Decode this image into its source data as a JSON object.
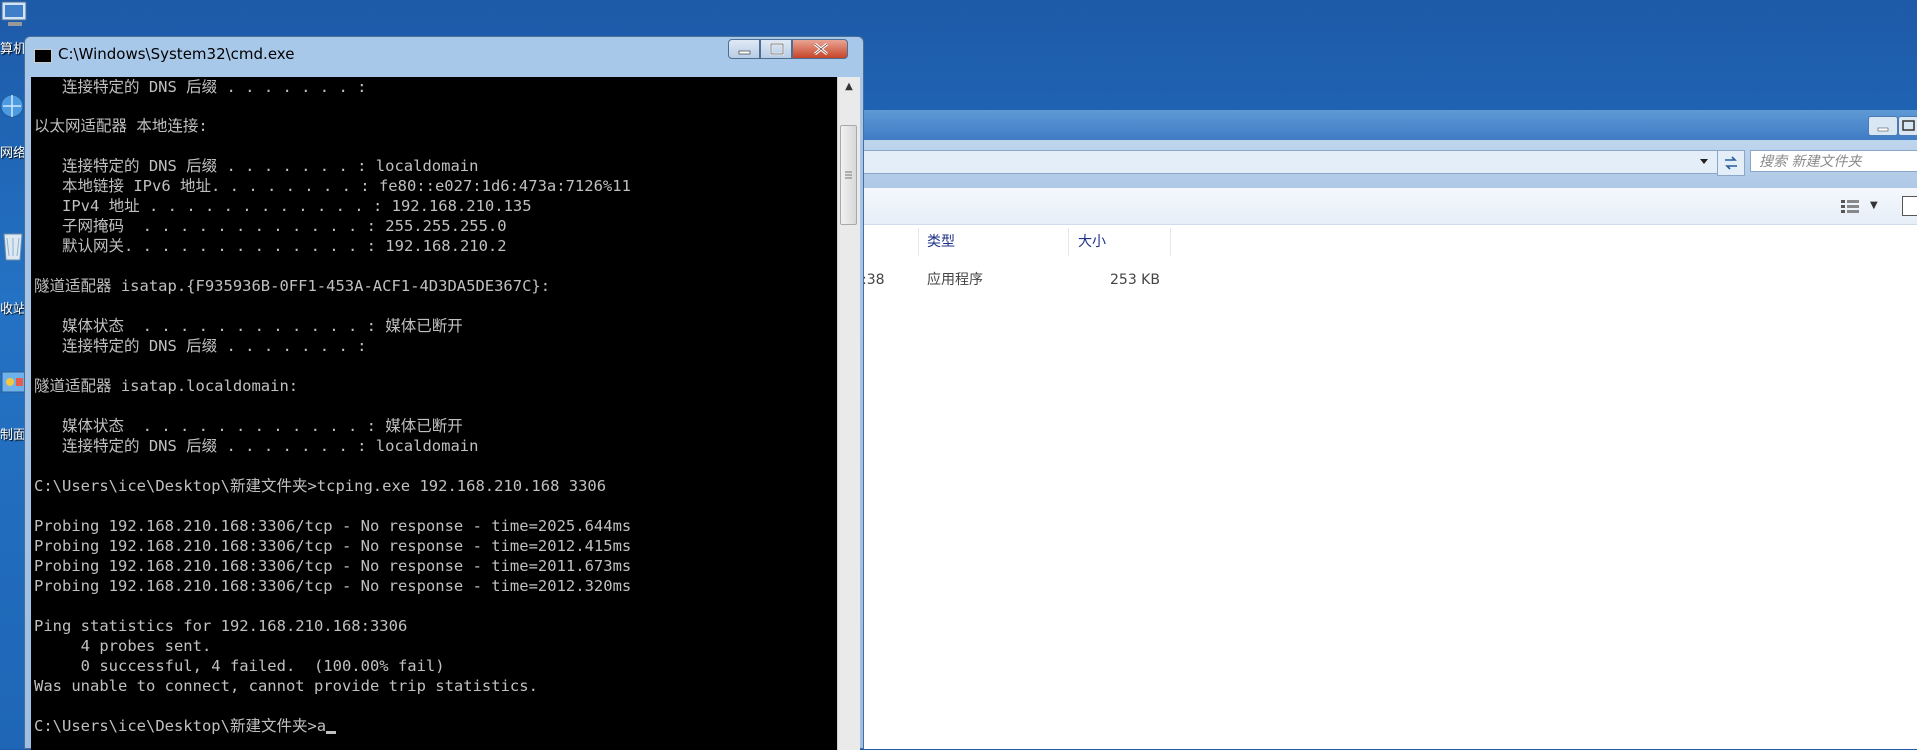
{
  "desktop": {
    "icons": [
      {
        "label": "算机",
        "icon": "computer-icon"
      },
      {
        "label": "网络",
        "icon": "network-icon"
      },
      {
        "label": "收站",
        "icon": "recycle-bin-icon"
      },
      {
        "label": "制面",
        "icon": "control-panel-icon"
      }
    ]
  },
  "explorer": {
    "search_placeholder": "搜索 新建文件夹",
    "columns": [
      "类型",
      "大小"
    ],
    "row": {
      "modified_fragment": ":38",
      "type": "应用程序",
      "size": "253 KB"
    }
  },
  "cmd": {
    "title": "C:\\Windows\\System32\\cmd.exe",
    "lines": [
      "   连接特定的 DNS 后缀 . . . . . . . :",
      "",
      "以太网适配器 本地连接:",
      "",
      "   连接特定的 DNS 后缀 . . . . . . . : localdomain",
      "   本地链接 IPv6 地址. . . . . . . . : fe80::e027:1d6:473a:7126%11",
      "   IPv4 地址 . . . . . . . . . . . . : 192.168.210.135",
      "   子网掩码  . . . . . . . . . . . . : 255.255.255.0",
      "   默认网关. . . . . . . . . . . . . : 192.168.210.2",
      "",
      "隧道适配器 isatap.{F935936B-0FF1-453A-ACF1-4D3DA5DE367C}:",
      "",
      "   媒体状态  . . . . . . . . . . . . : 媒体已断开",
      "   连接特定的 DNS 后缀 . . . . . . . :",
      "",
      "隧道适配器 isatap.localdomain:",
      "",
      "   媒体状态  . . . . . . . . . . . . : 媒体已断开",
      "   连接特定的 DNS 后缀 . . . . . . . : localdomain",
      "",
      "C:\\Users\\ice\\Desktop\\新建文件夹>tcping.exe 192.168.210.168 3306",
      "",
      "Probing 192.168.210.168:3306/tcp - No response - time=2025.644ms",
      "Probing 192.168.210.168:3306/tcp - No response - time=2012.415ms",
      "Probing 192.168.210.168:3306/tcp - No response - time=2011.673ms",
      "Probing 192.168.210.168:3306/tcp - No response - time=2012.320ms",
      "",
      "Ping statistics for 192.168.210.168:3306",
      "     4 probes sent.",
      "     0 successful, 4 failed.  (100.00% fail)",
      "Was unable to connect, cannot provide trip statistics.",
      "",
      "C:\\Users\\ice\\Desktop\\新建文件夹>a"
    ]
  }
}
